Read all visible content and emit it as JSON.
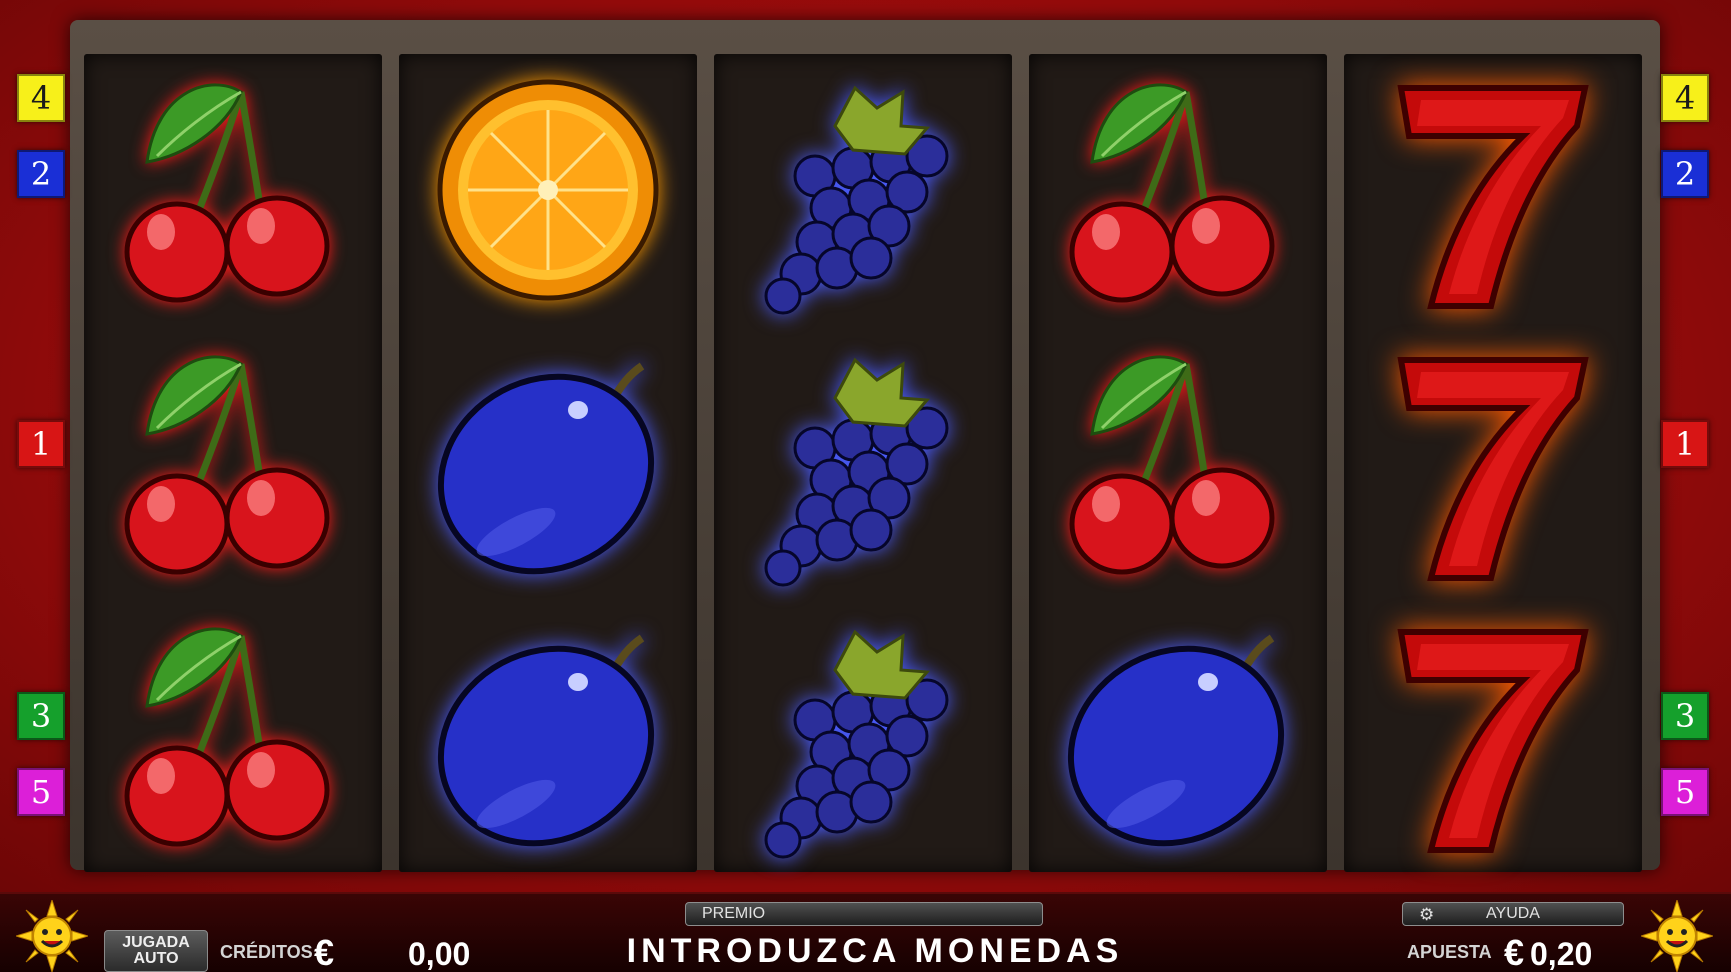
{
  "reels": [
    [
      "cherry",
      "cherry",
      "cherry"
    ],
    [
      "orange",
      "plum",
      "plum"
    ],
    [
      "grapes",
      "grapes",
      "grapes"
    ],
    [
      "cherry",
      "cherry",
      "plum"
    ],
    [
      "seven",
      "seven",
      "seven"
    ]
  ],
  "paylines": {
    "left": [
      {
        "label": "4",
        "color": "#f7f01a",
        "text": "#1a1a1a"
      },
      {
        "label": "2",
        "color": "#1a2fd6",
        "text": "#ffffff"
      },
      {
        "label": "1",
        "color": "#d81515",
        "text": "#ffffff"
      },
      {
        "label": "3",
        "color": "#15a02c",
        "text": "#ffffff"
      },
      {
        "label": "5",
        "color": "#dc1fd8",
        "text": "#ffffff"
      }
    ],
    "right": [
      {
        "label": "4",
        "color": "#f7f01a",
        "text": "#1a1a1a"
      },
      {
        "label": "2",
        "color": "#1a2fd6",
        "text": "#ffffff"
      },
      {
        "label": "1",
        "color": "#d81515",
        "text": "#ffffff"
      },
      {
        "label": "3",
        "color": "#15a02c",
        "text": "#ffffff"
      },
      {
        "label": "5",
        "color": "#dc1fd8",
        "text": "#ffffff"
      }
    ]
  },
  "footer": {
    "auto_line1": "JUGADA",
    "auto_line2": "AUTO",
    "credits_label": "CRÉDITOS",
    "credits_currency": "€",
    "credits_value": "0,00",
    "prize_label": "PREMIO",
    "message": "INTRODUZCA MONEDAS",
    "help_label": "AYUDA",
    "bet_label": "APUESTA",
    "bet_currency": "€",
    "bet_value": "0,20"
  }
}
